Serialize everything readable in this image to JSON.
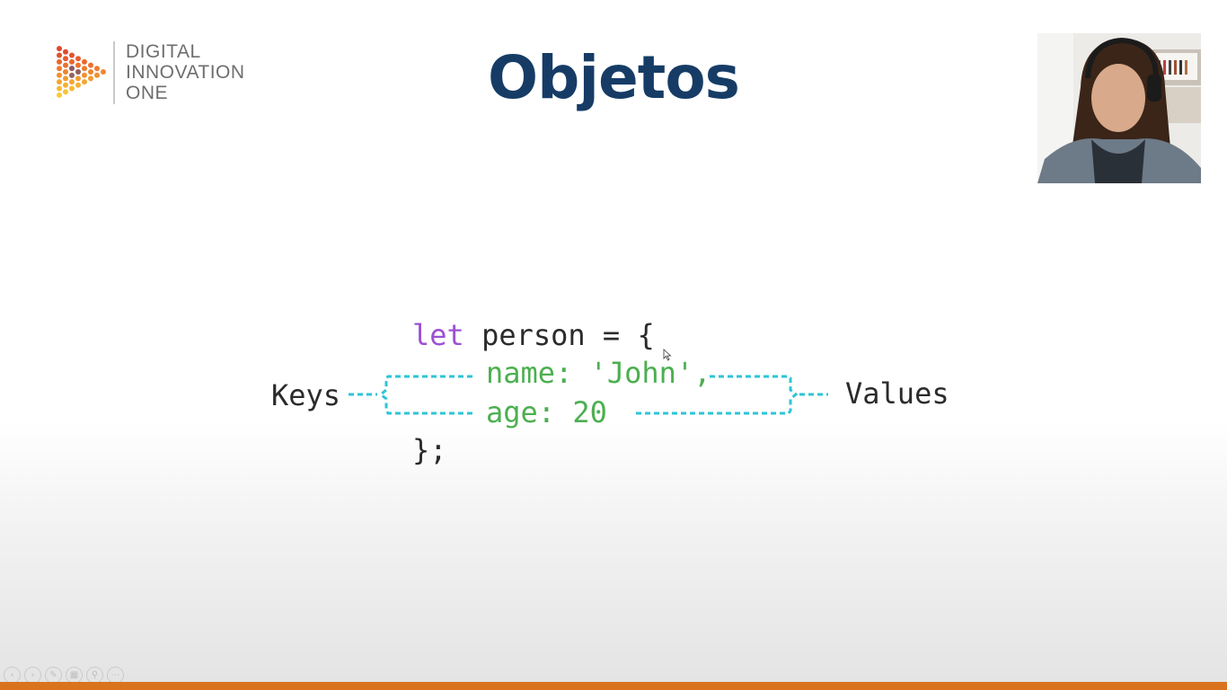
{
  "logo": {
    "line1": "DIGITAL",
    "line2": "INNOVATION",
    "line3": "ONE"
  },
  "title": "Objetos",
  "code": {
    "line1_keyword": "let",
    "line1_rest": " person = {",
    "line2": "name: 'John',",
    "line3": "age: 20",
    "line4": "};"
  },
  "labels": {
    "keys": "Keys",
    "values": "Values"
  },
  "colors": {
    "title": "#163c66",
    "keyword": "#9b51d4",
    "code_green": "#4caf50",
    "bracket_cyan": "#2ec4d6",
    "bottom_bar": "#d9731e"
  },
  "toolbar": {
    "icons": [
      "previous-slide-icon",
      "next-slide-icon",
      "pen-icon",
      "slides-grid-icon",
      "zoom-icon",
      "more-options-icon"
    ]
  }
}
